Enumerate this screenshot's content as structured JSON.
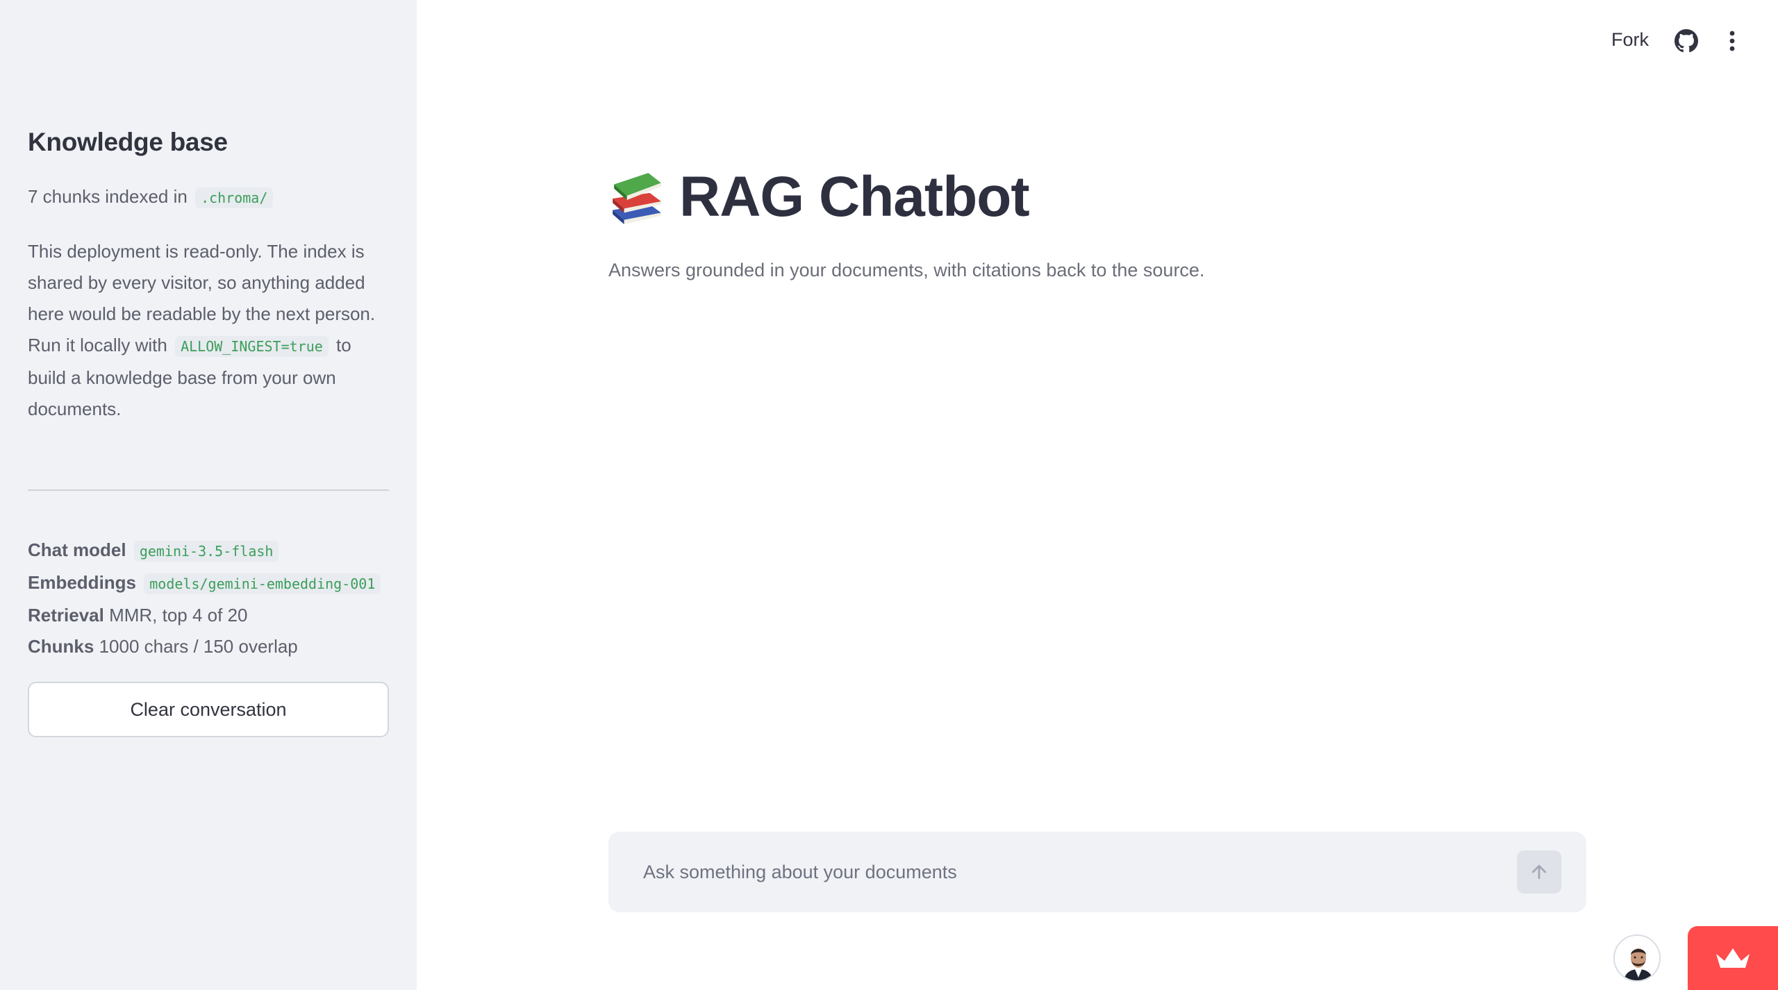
{
  "header": {
    "fork_label": "Fork",
    "icons": [
      "github-icon",
      "more-vertical-icon"
    ]
  },
  "sidebar": {
    "title": "Knowledge base",
    "count_prefix": "7 chunks indexed in",
    "count_path": ".chroma/",
    "note_part1": "This deployment is read-only. The index is shared by every visitor, so anything added here would be readable by the next person. Run it locally with",
    "note_code": "ALLOW_INGEST=true",
    "note_part2": "to build a knowledge base from your own documents.",
    "config": {
      "chat_model_label": "Chat model",
      "chat_model_value": "gemini-3.5-flash",
      "embeddings_label": "Embeddings",
      "embeddings_value": "models/gemini-embedding-001",
      "retrieval_label": "Retrieval",
      "retrieval_value": "MMR, top 4 of 20",
      "chunks_label": "Chunks",
      "chunks_value": "1000 chars / 150 overlap"
    },
    "clear_button_label": "Clear conversation"
  },
  "main": {
    "title_icon": "books-icon",
    "title": "RAG Chatbot",
    "subtitle": "Answers grounded in your documents, with citations back to the source."
  },
  "chat": {
    "placeholder": "Ask something about your documents",
    "value": "",
    "send_icon": "arrow-up-icon"
  },
  "colors": {
    "sidebar_bg": "#f0f2f6",
    "code_green": "#3b9e5a",
    "accent_red": "#ff4b4b",
    "text_dark": "#31333f"
  }
}
